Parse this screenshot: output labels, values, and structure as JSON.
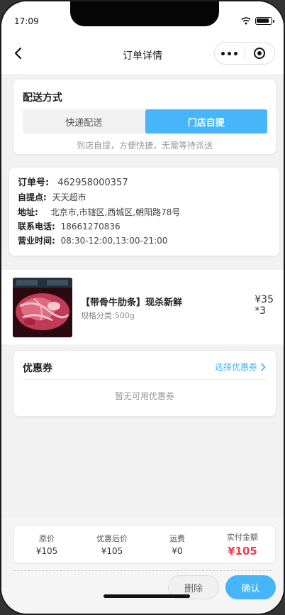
{
  "status_bar": {
    "time": "17:09"
  },
  "nav": {
    "title": "订单详情"
  },
  "delivery": {
    "title": "配送方式",
    "options": [
      "快递配送",
      "门店自提"
    ],
    "selected": "门店自提",
    "note": "到店自提，方便快捷，无需等待派送"
  },
  "order": {
    "order_no_label": "订单号:",
    "order_no": "462958000357",
    "pickup_label": "自提点:",
    "pickup": "天天超市",
    "address_label": "地址:",
    "address": "北京市,市辖区,西城区,朝阳路78号",
    "phone_label": "联系电话:",
    "phone": "18661270836",
    "hours_label": "营业时间:",
    "hours": "08:30-12:00,13:00-21:00"
  },
  "goods": {
    "name": "【带骨牛肋条】现杀新鲜",
    "spec": "规格分类:500g",
    "price": "¥35",
    "qty": "*3"
  },
  "coupon": {
    "title": "优惠券",
    "link": "选择优惠券",
    "empty": "暂无可用优惠券"
  },
  "summary": {
    "original_label": "原价",
    "original": "¥105",
    "discounted_label": "优惠后价",
    "discounted": "¥105",
    "shipping_label": "运费",
    "shipping": "¥0",
    "paid_label": "实付金额",
    "paid": "¥105"
  },
  "actions": {
    "delete": "删除",
    "confirm": "确认"
  },
  "colors": {
    "accent": "#46b5f9",
    "price_red": "#f03c4a"
  }
}
